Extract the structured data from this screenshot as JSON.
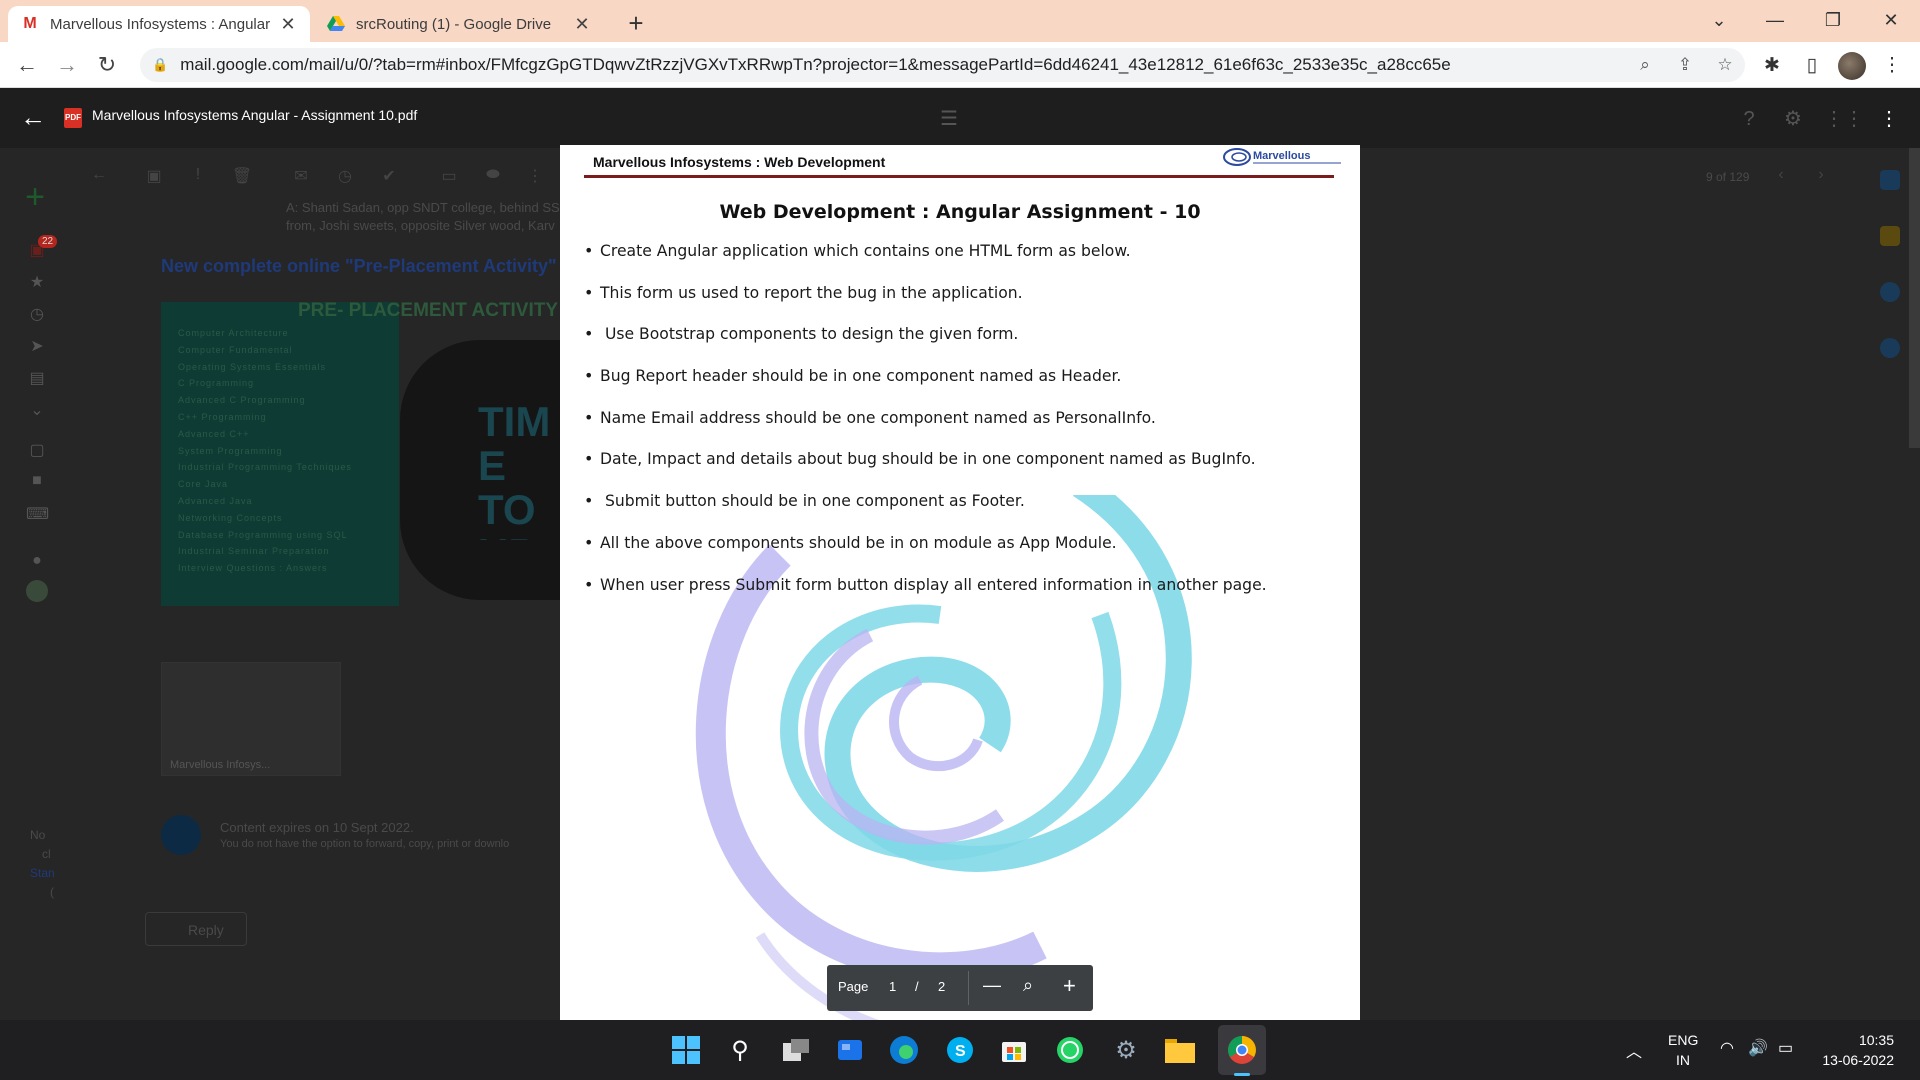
{
  "tabs": [
    {
      "title": "Marvellous Infosystems : Angular",
      "favicon": "gmail-icon"
    },
    {
      "title": "srcRouting (1) - Google Drive",
      "favicon": "google-drive-icon"
    }
  ],
  "address": {
    "url": "mail.google.com/mail/u/0/?tab=rm#inbox/FMfcgzGpGTDqwvZtRzzjVGXvTxRRwpTn?projector=1&messagePartId=6dd46241_43e12812_61e6f63c_2533e35c_a28cc65e"
  },
  "viewer": {
    "file_name": "Marvellous Infosystems Angular - Assignment 10.pdf",
    "pdf_badge": "PDF"
  },
  "gmail_bg": {
    "inbox_count": "22",
    "page_count": "9 of 129",
    "address_line1": "A: Shanti Sadan, opp SNDT college, behind SS",
    "address_line2": "from, Joshi sweets, opposite Silver wood, Karv",
    "promo_link": "New complete online \"Pre-Placement Activity\"",
    "poster_heading": "PRE- PLACEMENT ACTIVITY",
    "poster_items": [
      "Computer Architecture",
      "Computer Fundamental",
      "Operating Systems Essentials",
      "C Programming",
      "Advanced C Programming",
      "C++ Programming",
      "Advanced C++",
      "System Programming",
      "Industrial Programming Techniques",
      "Core Java",
      "Advanced Java",
      "Networking Concepts",
      "Database Programming using SQL",
      "Industrial Seminar Preparation",
      "Interview Questions : Answers"
    ],
    "poster_big": "TIME TO UPDA",
    "attachment_label": "Marvellous Infosys...",
    "expires": "Content expires on 10 Sept 2022.",
    "expires_note": "You do not have the option to forward, copy, print or downlo",
    "reply": "Reply",
    "left_note": [
      "No",
      "cl",
      "Stan",
      "("
    ]
  },
  "pdf": {
    "header": "Marvellous Infosystems : Web Development",
    "logo_text": "Marvellous",
    "title": "Web Development : Angular Assignment - 10",
    "bullets": [
      "Create Angular application which contains one HTML form as below.",
      "This form us used to report the bug in the application.",
      " Use Bootstrap components to design the given form.",
      "Bug Report header should be in one component named as Header.",
      "Name Email address should be one component named as PersonalInfo.",
      "Date, Impact and details about bug should be in one component named as BugInfo.",
      " Submit button should be in one component as Footer.",
      "All the above components should be in on module as App Module.",
      "When user press Submit form button display all entered information in another page."
    ]
  },
  "pdf_controls": {
    "page_label": "Page",
    "current": "1",
    "separator": "/",
    "total": "2"
  },
  "tray": {
    "language": "ENG",
    "region": "IN",
    "time": "10:35",
    "date": "13-06-2022"
  },
  "colors": {
    "tabstrip": "#f8d7c4",
    "pdf_rule": "#7a1c1c",
    "swirl_cyan": "#7fd8e8",
    "swirl_violet": "#b9b4f2"
  }
}
